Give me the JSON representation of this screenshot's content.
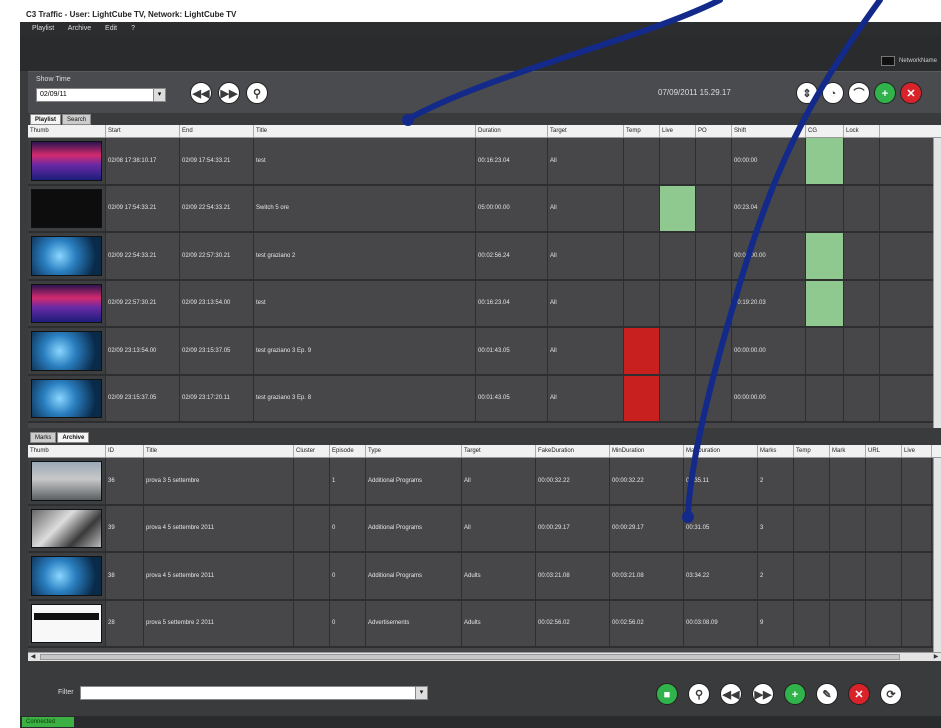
{
  "window": {
    "title": "C3 Traffic - User: LightCube TV, Network: LightCube TV"
  },
  "menu": [
    "Playlist",
    "Archive",
    "Edit",
    "?"
  ],
  "network_badge": "NetworkName",
  "toolbar": {
    "show_time_label": "Show Time",
    "show_time_value": "02/09/11",
    "datetime": "07/09/2011 15.29.17",
    "left_buttons": [
      {
        "icon": "rewind-icon",
        "glyph": "◀◀"
      },
      {
        "icon": "fast-forward-icon",
        "glyph": "▶▶"
      },
      {
        "icon": "search-icon",
        "glyph": "⚲"
      }
    ],
    "right_buttons": [
      {
        "icon": "resize-vertical-icon",
        "glyph": "⇕",
        "style": "white"
      },
      {
        "icon": "clock-icon",
        "glyph": "◔",
        "style": "white"
      },
      {
        "icon": "arc-icon",
        "glyph": "⌒",
        "style": "white"
      },
      {
        "icon": "add-icon",
        "glyph": "+",
        "style": "green"
      },
      {
        "icon": "delete-icon",
        "glyph": "✕",
        "style": "red"
      }
    ]
  },
  "top_tabs": [
    {
      "label": "Playlist",
      "active": true
    },
    {
      "label": "Search",
      "active": false
    }
  ],
  "playlist": {
    "columns": [
      "Thumb",
      "Start",
      "End",
      "Title",
      "Duration",
      "Target",
      "Temp",
      "Live",
      "PO",
      "Shift",
      "CG",
      "Lock"
    ],
    "rows": [
      {
        "thumb": "redblue",
        "start": "02/08 17:38:10.17",
        "end": "02/09 17:54:33.21",
        "title": "test",
        "duration": "00:16:23.04",
        "target": "All",
        "temp": "",
        "live": "",
        "po": "",
        "shift": "00:00:00",
        "cg": "",
        "lock": "",
        "temp_red": false,
        "live_green": false,
        "cg_green": true
      },
      {
        "thumb": "dish",
        "start": "02/09 17:54:33.21",
        "end": "02/09 22:54:33.21",
        "title": "Switch 5 ore",
        "duration": "05:00:00.00",
        "target": "All",
        "temp": "",
        "live": "",
        "po": "",
        "shift": "00:23.04",
        "cg": "",
        "lock": "",
        "temp_red": false,
        "live_green": true,
        "cg_green": false
      },
      {
        "thumb": "blueglow",
        "start": "02/09 22:54:33.21",
        "end": "02/09 22:57:30.21",
        "title": "test graziano 2",
        "duration": "00:02:56.24",
        "target": "All",
        "temp": "",
        "live": "",
        "po": "",
        "shift": "00:00:00.00",
        "cg": "",
        "lock": "",
        "temp_red": false,
        "live_green": false,
        "cg_green": true
      },
      {
        "thumb": "redblue",
        "start": "02/09 22:57:30.21",
        "end": "02/09 23:13:54.00",
        "title": "test",
        "duration": "00:16:23.04",
        "target": "All",
        "temp": "",
        "live": "",
        "po": "",
        "shift": "00:19:20.03",
        "cg": "",
        "lock": "",
        "temp_red": false,
        "live_green": false,
        "cg_green": true
      },
      {
        "thumb": "blueglow",
        "start": "02/09 23:13:54.00",
        "end": "02/09 23:15:37.05",
        "title": "test graziano 3 Ep. 9",
        "duration": "00:01:43.05",
        "target": "All",
        "temp": "",
        "live": "",
        "po": "",
        "shift": "00:00:00.00",
        "cg": "",
        "lock": "",
        "temp_red": true,
        "live_green": false,
        "cg_green": false
      },
      {
        "thumb": "blueglow",
        "start": "02/09 23:15:37.05",
        "end": "02/09 23:17:20.11",
        "title": "test graziano 3 Ep. 8",
        "duration": "00:01:43.05",
        "target": "All",
        "temp": "",
        "live": "",
        "po": "",
        "shift": "00:00:00.00",
        "cg": "",
        "lock": "",
        "temp_red": true,
        "live_green": false,
        "cg_green": false
      }
    ]
  },
  "bottom_tabs": [
    {
      "label": "Marks",
      "active": false
    },
    {
      "label": "Archive",
      "active": true
    }
  ],
  "archive": {
    "columns": [
      "Thumb",
      "ID",
      "Title",
      "Cluster",
      "Episode",
      "Type",
      "Target",
      "FakeDuration",
      "MinDuration",
      "MaxDuration",
      "Marks",
      "Temp",
      "Mark",
      "URL",
      "Live"
    ],
    "rows": [
      {
        "thumb": "building",
        "id": "36",
        "title": "prova 3 5 settembre",
        "cluster": "",
        "episode": "1",
        "type": "Additional Programs",
        "target": "All",
        "fake": "00:00:32.22",
        "min": "00:00:32.22",
        "max": "00:35.11",
        "marks": "2"
      },
      {
        "thumb": "crowd",
        "id": "39",
        "title": "prova 4 5 settembre 2011",
        "cluster": "",
        "episode": "0",
        "type": "Additional Programs",
        "target": "All",
        "fake": "00:00:29.17",
        "min": "00:00:29.17",
        "max": "00:31.05",
        "marks": "3"
      },
      {
        "thumb": "blueglow",
        "id": "38",
        "title": "prova 4 5 settembre 2011",
        "cluster": "",
        "episode": "0",
        "type": "Additional Programs",
        "target": "Adults",
        "fake": "00:03:21.08",
        "min": "00:03:21.08",
        "max": "03:34.22",
        "marks": "2"
      },
      {
        "thumb": "tape",
        "id": "28",
        "title": "prova 5 settembre 2 2011",
        "cluster": "",
        "episode": "0",
        "type": "Advertisements",
        "target": "Adults",
        "fake": "00:02:56.02",
        "min": "00:02:56.02",
        "max": "00:03:08.09",
        "marks": "9"
      }
    ]
  },
  "filter": {
    "label": "Filter",
    "value": ""
  },
  "bottom_buttons": [
    {
      "icon": "archive-icon",
      "glyph": "■",
      "style": "green"
    },
    {
      "icon": "search-icon",
      "glyph": "⚲",
      "style": "white"
    },
    {
      "icon": "rewind-icon",
      "glyph": "◀◀",
      "style": "white"
    },
    {
      "icon": "fast-forward-icon",
      "glyph": "▶▶",
      "style": "white"
    },
    {
      "icon": "add-icon",
      "glyph": "+",
      "style": "green"
    },
    {
      "icon": "edit-icon",
      "glyph": "✎",
      "style": "white"
    },
    {
      "icon": "delete-icon",
      "glyph": "✕",
      "style": "red"
    },
    {
      "icon": "refresh-icon",
      "glyph": "⟳",
      "style": "white"
    }
  ],
  "status": {
    "text": "Connected"
  },
  "colors": {
    "accent_green": "#2fb34a",
    "accent_red": "#d9232b",
    "cell_green": "#8fc98f",
    "cell_red": "#c8201f",
    "annotation_blue": "#132a8a"
  }
}
